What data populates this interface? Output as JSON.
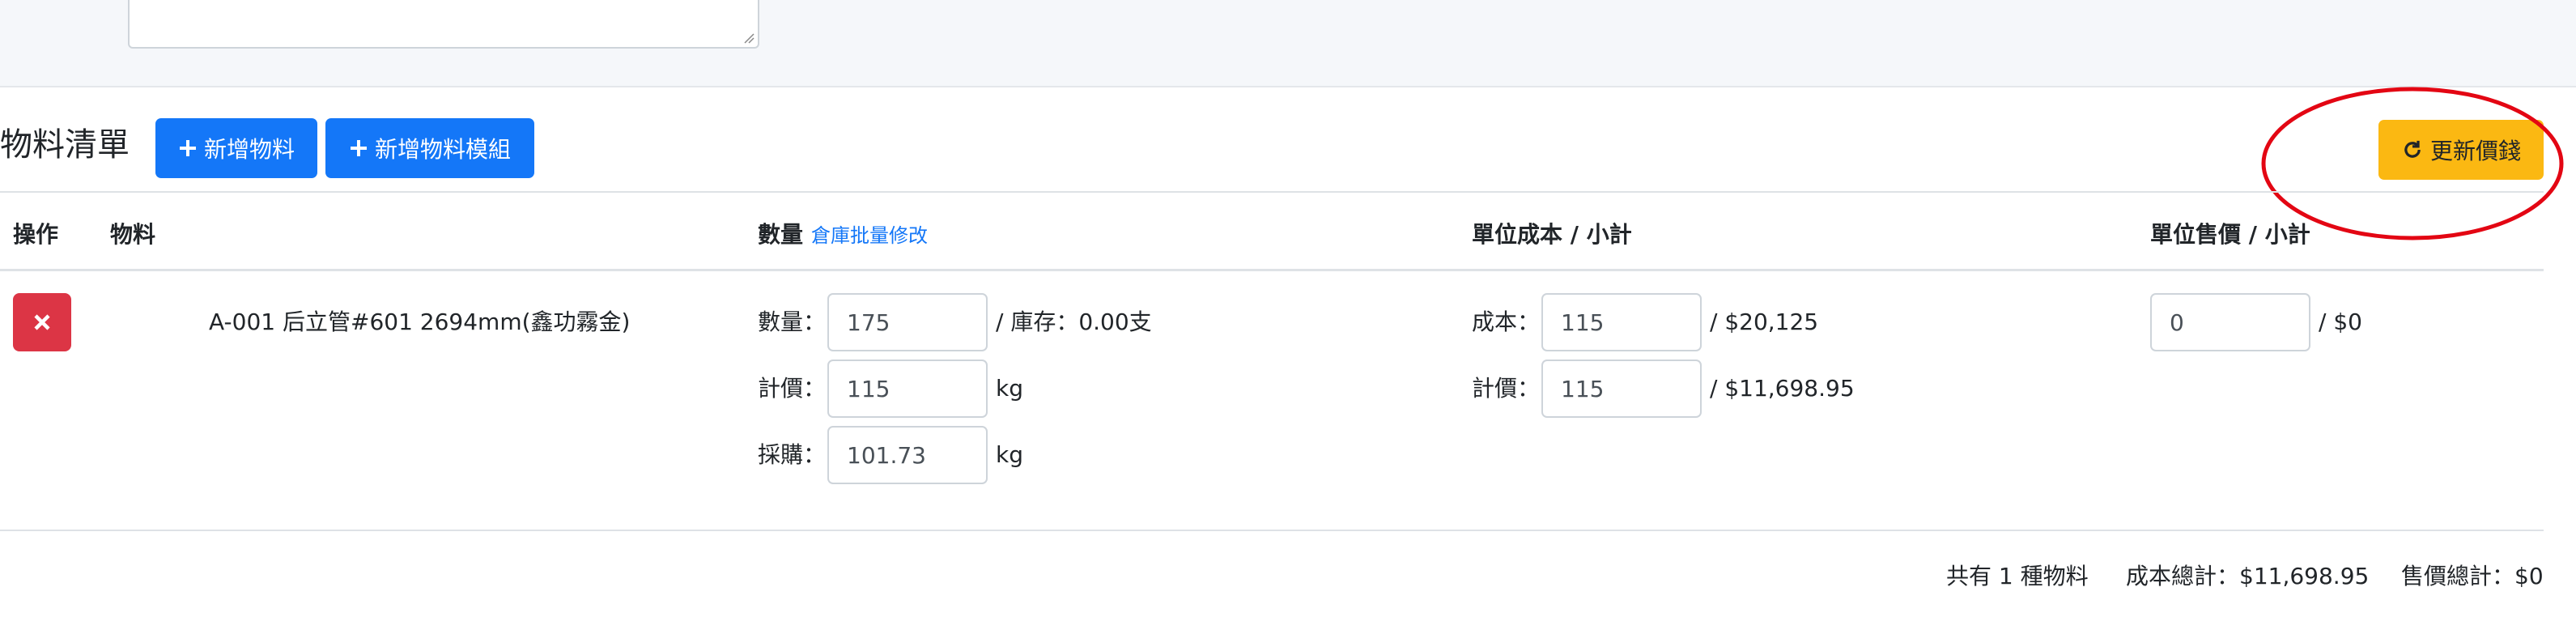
{
  "materials_section": {
    "title": "物料清單",
    "add_material_label": "新增物料",
    "add_module_label": "新增物料模組",
    "update_price_label": "更新價錢"
  },
  "table": {
    "headers": {
      "action": "操作",
      "material": "物料",
      "quantity": "數量",
      "quantity_link": "倉庫批量修改",
      "unit_cost": "單位成本 / 小計",
      "unit_price": "單位售價 / 小計"
    },
    "rows": [
      {
        "material_name": "A-001 后立管#601 2694mm(鑫功霧金)",
        "quantity_label": "數量：",
        "quantity_value": "175",
        "stock_text": "/ 庫存：0.00支",
        "pricing_label": "計價：",
        "pricing_value": "115",
        "pricing_unit": "kg",
        "purchase_label": "採購：",
        "purchase_value": "101.73",
        "purchase_unit": "kg",
        "cost_label": "成本：",
        "cost_value": "115",
        "cost_subtotal": "/ $20,125",
        "cost_pricing_label": "計價：",
        "cost_pricing_value": "115",
        "cost_pricing_subtotal": "/ $11,698.95",
        "sale_value": "0",
        "sale_subtotal": "/ $0"
      }
    ]
  },
  "summary": {
    "count_text": "共有 1 種物料",
    "cost_total": "成本總計：$11,698.95",
    "price_total": "售價總計：$0"
  },
  "colors": {
    "primary": "#1477f8",
    "warning": "#fbb812",
    "danger": "#dc3545",
    "annotation": "#e30613"
  }
}
